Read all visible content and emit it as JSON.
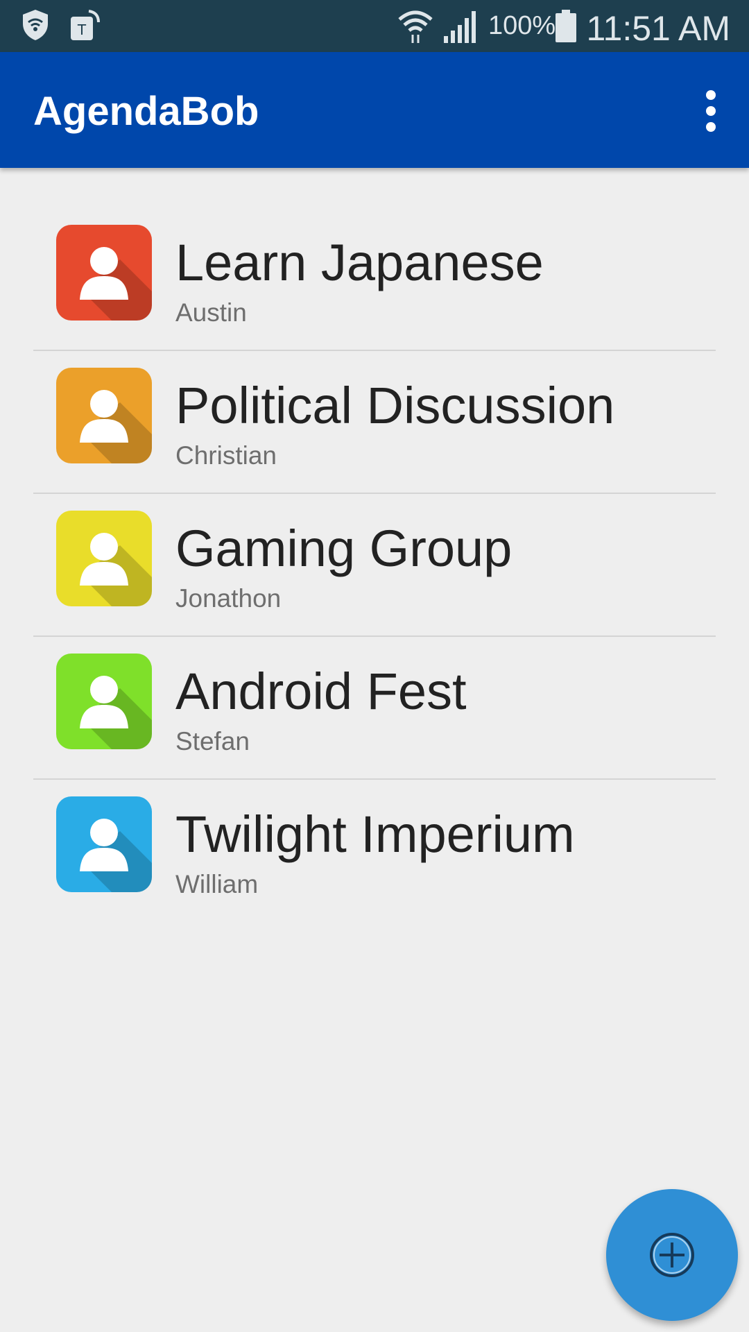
{
  "status_bar": {
    "icons": [
      "shield-wifi-icon",
      "tmobile-tag-icon",
      "wifi-icon",
      "signal-icon",
      "battery-icon"
    ],
    "battery": "100%",
    "time": "11:51 AM"
  },
  "app_bar": {
    "title": "AgendaBob",
    "menu_icon": "more-vert-icon"
  },
  "agendas": [
    {
      "title": "Learn Japanese",
      "owner": "Austin",
      "color": "#e64a2e"
    },
    {
      "title": "Political Discussion",
      "owner": "Christian",
      "color": "#eba02a"
    },
    {
      "title": "Gaming Group",
      "owner": "Jonathon",
      "color": "#e9dd2a"
    },
    {
      "title": "Android Fest",
      "owner": "Stefan",
      "color": "#7fe02a"
    },
    {
      "title": "Twilight Imperium",
      "owner": "William",
      "color": "#2aace6"
    }
  ],
  "fab": {
    "icon": "add-circle-icon"
  },
  "colors": {
    "status_bar": "#1e3f4f",
    "app_bar": "#0047ab",
    "background": "#eeeeee",
    "fab": "#2f8fd5"
  }
}
